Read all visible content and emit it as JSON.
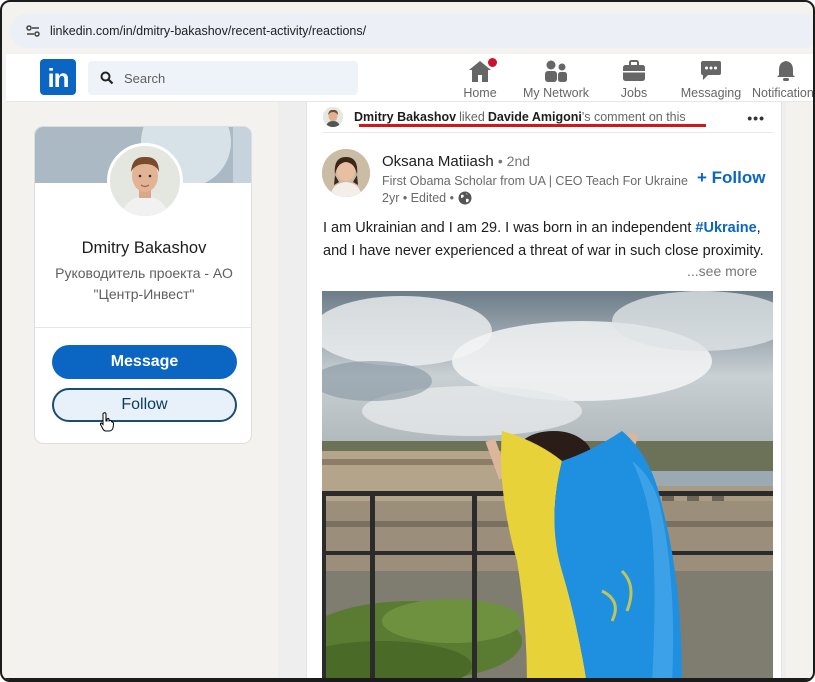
{
  "browser": {
    "url": "linkedin.com/in/dmitry-bakashov/recent-activity/reactions/"
  },
  "nav": {
    "logo_text": "in",
    "search_placeholder": "Search",
    "items": [
      {
        "label": "Home",
        "icon": "home-icon"
      },
      {
        "label": "My Network",
        "icon": "network-icon"
      },
      {
        "label": "Jobs",
        "icon": "briefcase-icon"
      },
      {
        "label": "Messaging",
        "icon": "chat-icon"
      },
      {
        "label": "Notifications",
        "icon": "bell-icon"
      }
    ]
  },
  "profile": {
    "name": "Dmitry Bakashov",
    "title": "Руководитель проекта - АО \"Центр-Инвест\"",
    "message_label": "Message",
    "follow_label": "Follow"
  },
  "activity": {
    "actor": "Dmitry Bakashov",
    "verb": "liked",
    "target": "Davide Amigoni",
    "suffix": "'s comment on this",
    "more": "•••"
  },
  "post": {
    "author": "Oksana Matiiash",
    "degree": "• 2nd",
    "headline": "First Obama Scholar from UA | CEO Teach For Ukraine",
    "time": "2yr • Edited •",
    "follow_label": "+ Follow",
    "text_before": "I am Ukrainian and I am 29. I was born in an independent",
    "hashtag": "#Ukraine",
    "text_after": ", and I have never experienced a threat of war in such close proximity.",
    "see_more": "...see more"
  },
  "colors": {
    "brand": "#0a66c2",
    "flag_blue": "#1f8fe0",
    "flag_yellow": "#e8d23a",
    "highlight_line": "#d6141c"
  }
}
